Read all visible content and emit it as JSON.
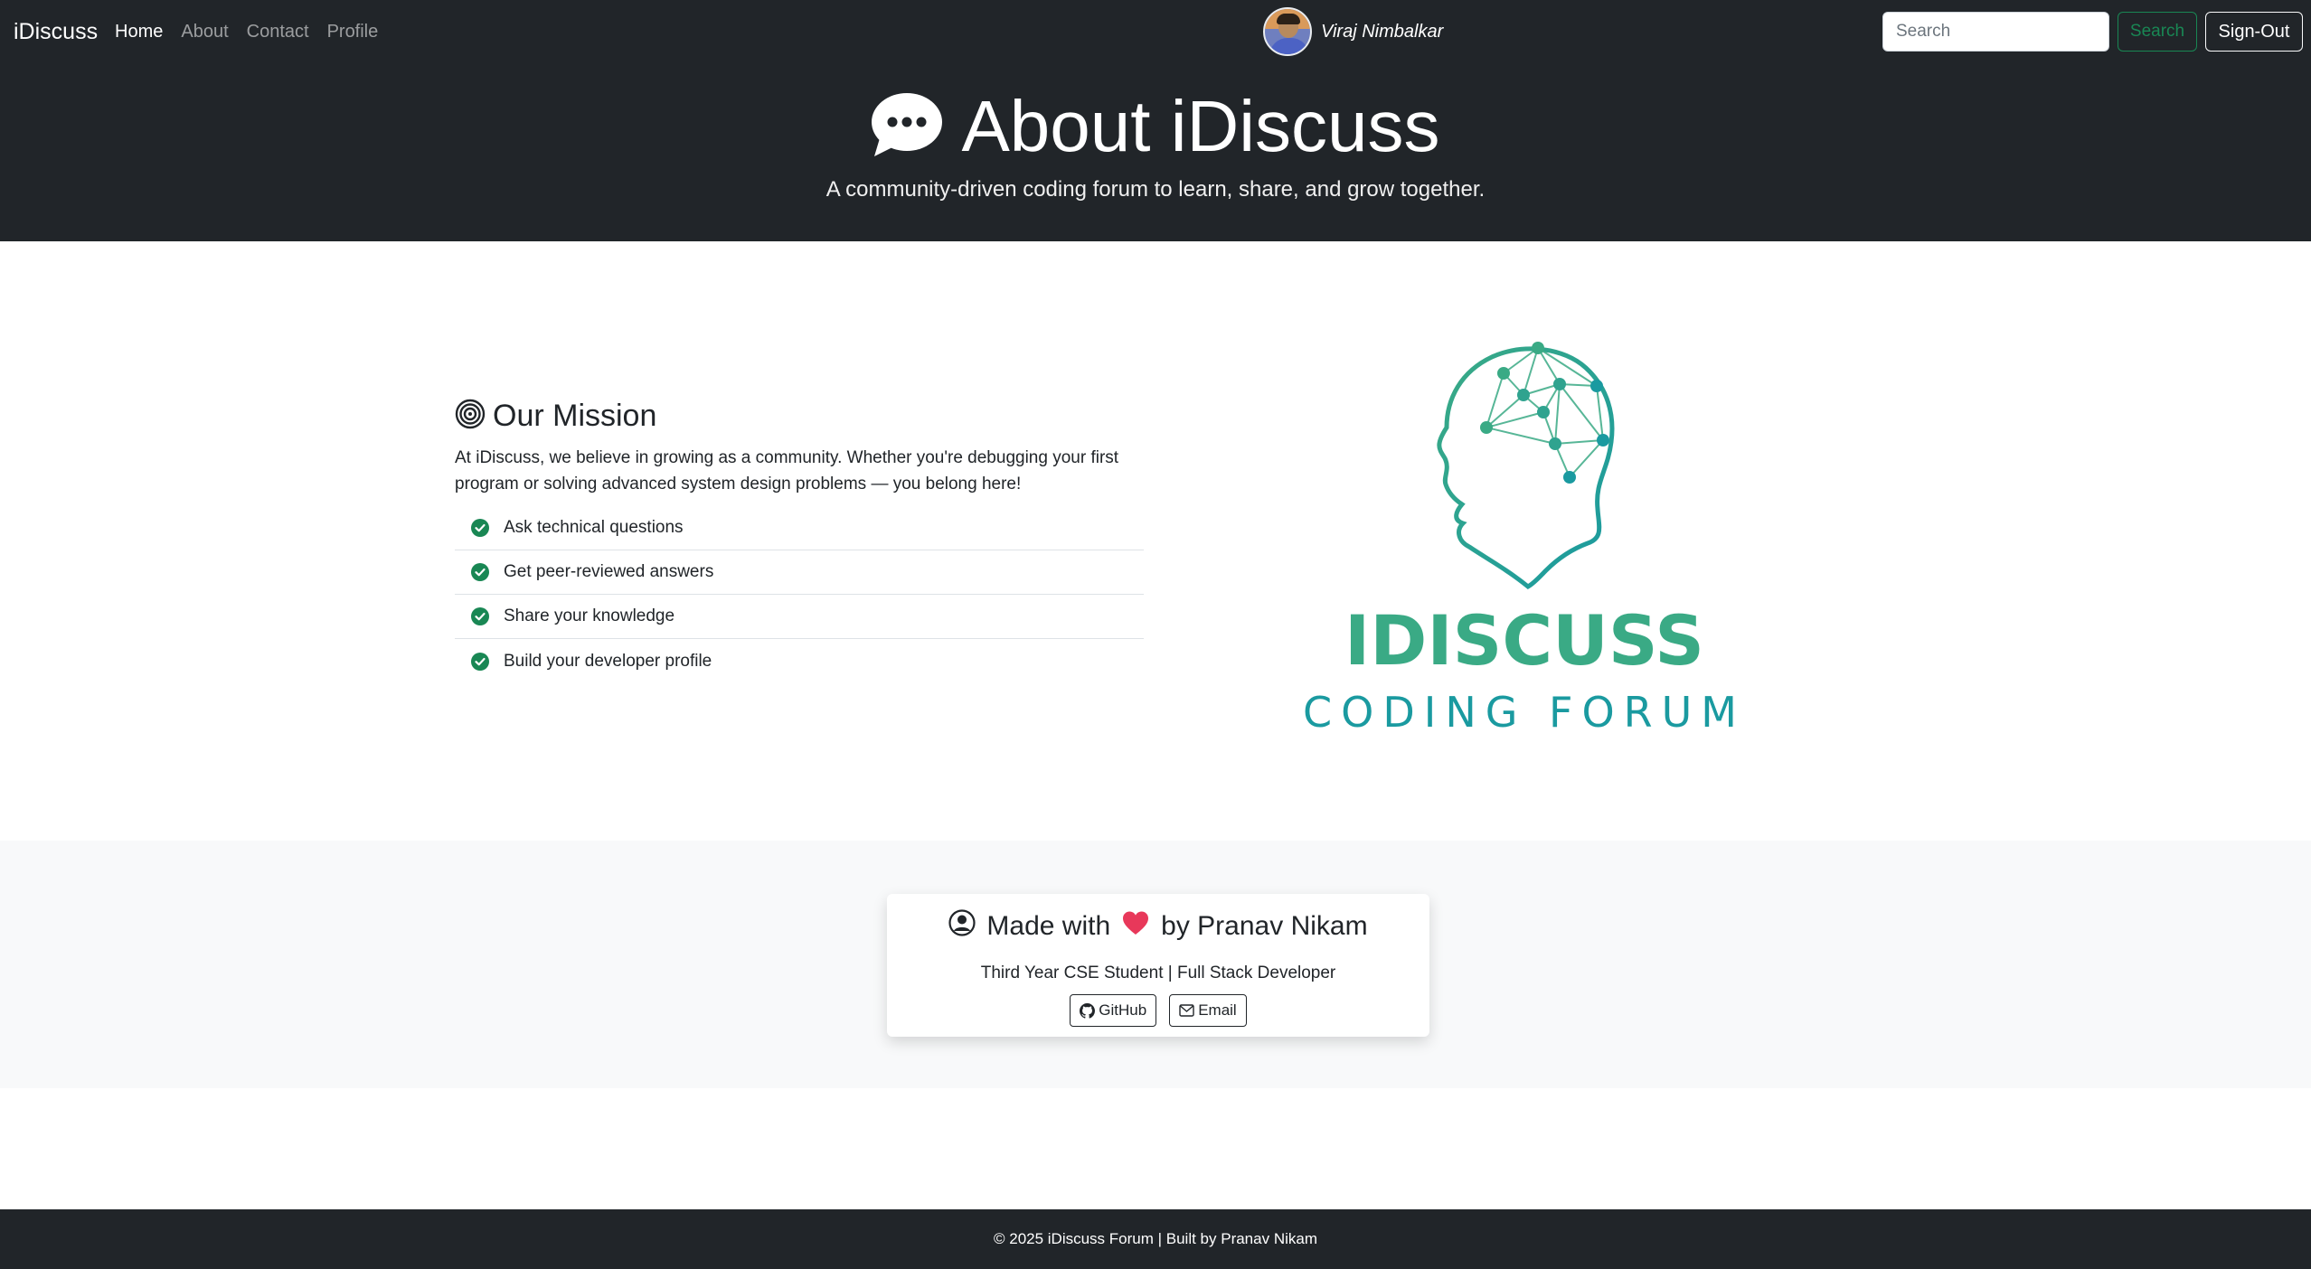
{
  "navbar": {
    "brand": "iDiscuss",
    "links": [
      {
        "label": "Home",
        "active": true
      },
      {
        "label": "About",
        "active": false
      },
      {
        "label": "Contact",
        "active": false
      },
      {
        "label": "Profile",
        "active": false
      }
    ],
    "user_name": "Viraj Nimbalkar",
    "search_placeholder": "Search",
    "search_button": "Search",
    "signout_button": "Sign-Out"
  },
  "hero": {
    "title": "About iDiscuss",
    "subtitle": "A community-driven coding forum to learn, share, and grow together."
  },
  "mission": {
    "title": "Our Mission",
    "text": "At iDiscuss, we believe in growing as a community. Whether you're debugging your first program or solving advanced system design problems — you belong here!",
    "items": [
      "Ask technical questions",
      "Get peer-reviewed answers",
      "Share your knowledge",
      "Build your developer profile"
    ]
  },
  "logo": {
    "word1": "IDISCUSS",
    "word2": "CODING FORUM"
  },
  "credit": {
    "made_with": "Made with",
    "by": "by Pranav Nikam",
    "subtitle": "Third Year CSE Student | Full Stack Developer",
    "github_label": "GitHub",
    "email_label": "Email"
  },
  "footer": {
    "text": "© 2025 iDiscuss Forum | Built by Pranav Nikam"
  },
  "colors": {
    "dark": "#212529",
    "success": "#198754",
    "logo_green": "#3aaa85",
    "logo_teal": "#1a9aa0",
    "light_bg": "#f8f9fa"
  }
}
